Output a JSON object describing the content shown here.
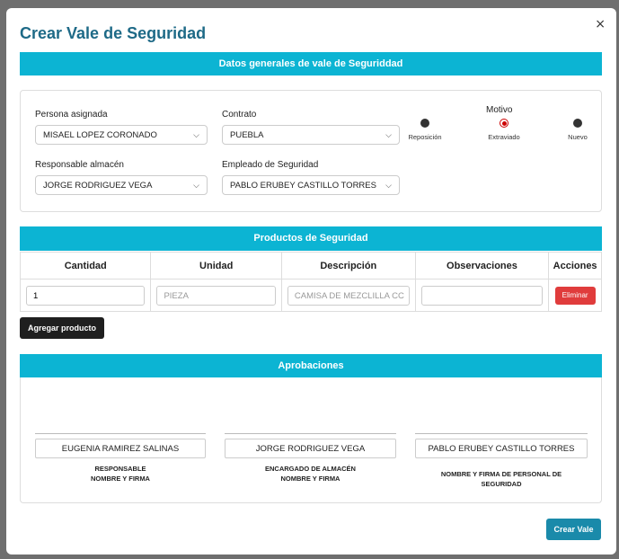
{
  "modal": {
    "title": "Crear Vale de Seguridad",
    "close": "×"
  },
  "general": {
    "header": "Datos generales de vale de Seguriddad",
    "persona_label": "Persona asignada",
    "persona_value": "MISAEL LOPEZ CORONADO",
    "contrato_label": "Contrato",
    "contrato_value": "PUEBLA",
    "responsable_label": "Responsable almacén",
    "responsable_value": "JORGE RODRIGUEZ VEGA",
    "empleado_label": "Empleado de Seguridad",
    "empleado_value": "PABLO ERUBEY CASTILLO TORRES",
    "motivo_label": "Motivo",
    "motivo_options": [
      "Reposición",
      "Extraviado",
      "Nuevo"
    ],
    "motivo_selected": "Extraviado"
  },
  "products": {
    "header": "Productos de Seguridad",
    "columns": [
      "Cantidad",
      "Unidad",
      "Descripción",
      "Observaciones",
      "Acciones"
    ],
    "rows": [
      {
        "cantidad": "1",
        "unidad": "PIEZA",
        "descripcion": "CAMISA DE MEZCLILLA CC",
        "observaciones": "",
        "action": "Eliminar"
      }
    ],
    "add_label": "Agregar producto"
  },
  "approvals": {
    "header": "Aprobaciones",
    "signatures": [
      {
        "name": "EUGENIA  RAMIREZ SALINAS",
        "caption1": "RESPONSABLE",
        "caption2": "NOMBRE Y FIRMA"
      },
      {
        "name": "JORGE  RODRIGUEZ VEGA",
        "caption1": "ENCARGADO DE ALMACÉN",
        "caption2": "NOMBRE Y FIRMA"
      },
      {
        "name": "PABLO ERUBEY  CASTILLO TORRES",
        "caption1": "NOMBRE Y FIRMA DE PERSONAL DE",
        "caption2": "SEGURIDAD"
      }
    ]
  },
  "footer": {
    "submit_label": "Crear Vale"
  },
  "colors": {
    "accent": "#0cb4d3",
    "title": "#1e6a87",
    "danger": "#e03c3c",
    "primary_button": "#1a8aaa"
  }
}
